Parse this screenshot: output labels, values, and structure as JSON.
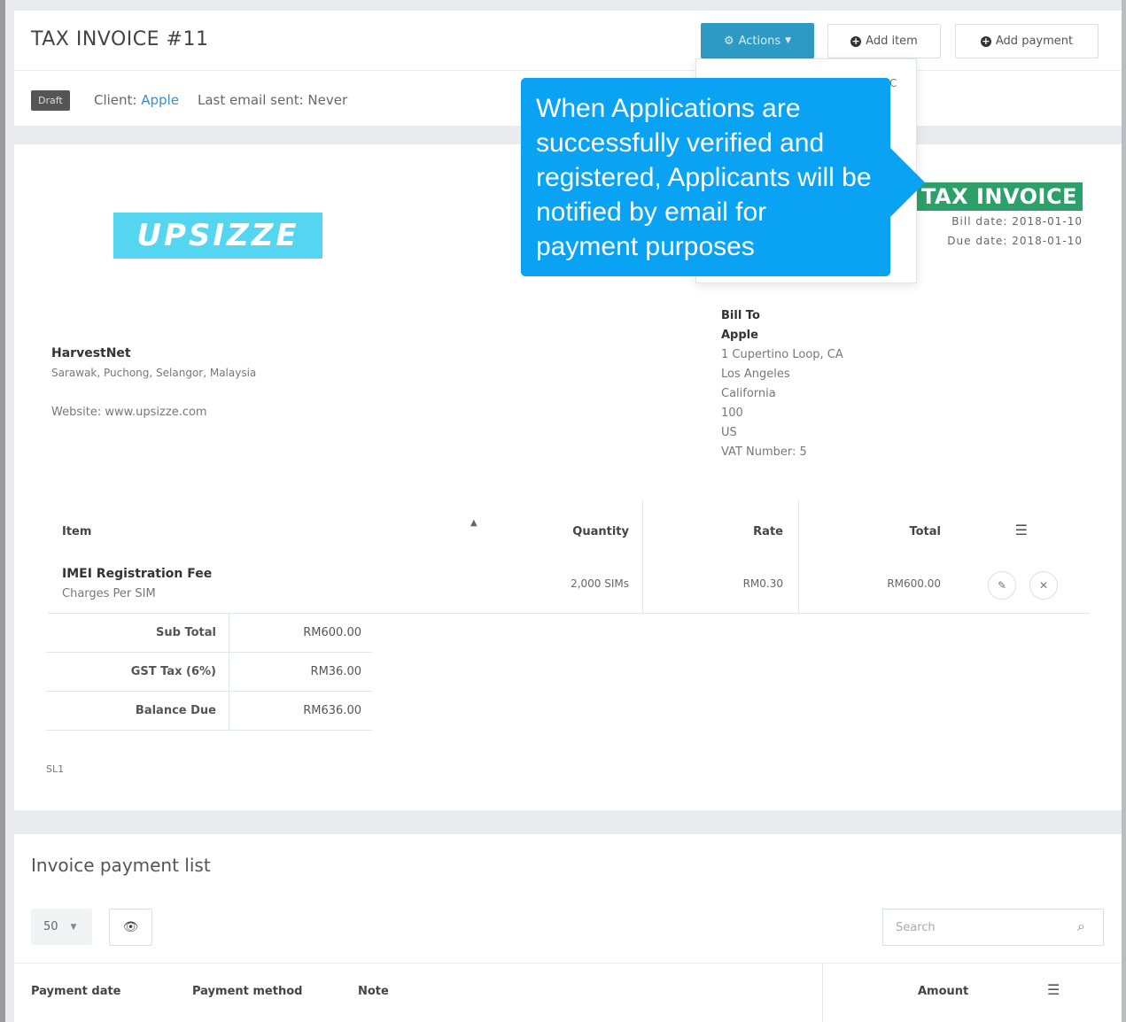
{
  "header": {
    "title": "TAX INVOICE #11",
    "actions_label": "Actions",
    "add_item_label": "Add item",
    "add_payment_label": "Add payment",
    "status": "Draft",
    "client_prefix": "Client:",
    "client_name": "Apple",
    "last_email": "Last email sent: Never"
  },
  "dropdown": {
    "visible_fragment": "C"
  },
  "callout": {
    "text": "When Applications are successfully verified and registered, Applicants will be notified by email for payment purposes"
  },
  "invoice": {
    "logo_text": "UPSIZZE",
    "label": "TAX INVOICE #11",
    "bill_date": "Bill date: 2018-01-10",
    "due_date": "Due date: 2018-01-10",
    "company": {
      "name": "HarvestNet",
      "address": "Sarawak, Puchong, Selangor, Malaysia",
      "website": "Website: www.upsizze.com"
    },
    "bill_to": {
      "heading": "Bill To",
      "name": "Apple",
      "street": "1 Cupertino Loop, CA",
      "city": "Los Angeles",
      "state": "California",
      "zip": "100",
      "country": "US",
      "vat": "VAT Number: 5"
    },
    "items_columns": {
      "item": "Item",
      "quantity": "Quantity",
      "rate": "Rate",
      "total": "Total"
    },
    "items": [
      {
        "name": "IMEI Registration Fee",
        "description": "Charges Per SIM",
        "quantity": "2,000 SIMs",
        "rate": "RM0.30",
        "total": "RM600.00"
      }
    ],
    "totals": [
      {
        "label": "Sub Total",
        "value": "RM600.00"
      },
      {
        "label": "GST Tax (6%)",
        "value": "RM36.00"
      },
      {
        "label": "Balance Due",
        "value": "RM636.00"
      }
    ],
    "note": "SL1"
  },
  "payments": {
    "title": "Invoice payment list",
    "page_size": "50",
    "search_placeholder": "Search",
    "columns": {
      "date": "Payment date",
      "method": "Payment method",
      "note": "Note",
      "amount": "Amount"
    }
  }
}
